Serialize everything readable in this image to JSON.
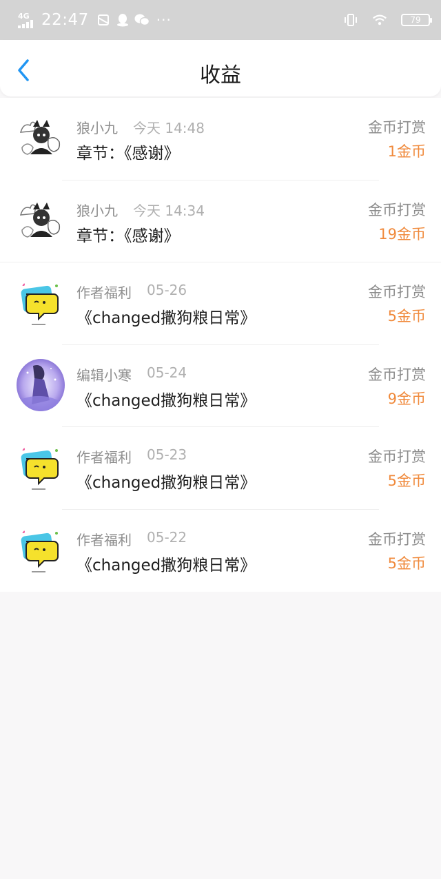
{
  "status_bar": {
    "network": "4G",
    "time": "22:47",
    "dots": "···",
    "battery": "79"
  },
  "header": {
    "title": "收益"
  },
  "colors": {
    "accent_blue": "#2196f3",
    "amount_orange": "#f08a3c"
  },
  "records": [
    {
      "name": "狼小九",
      "time": "今天 14:48",
      "content": "章节：《感谢》",
      "type": "金币打赏",
      "amount": "1金币",
      "avatar": "wolf-avatar-icon"
    },
    {
      "name": "狼小九",
      "time": "今天 14:34",
      "content": "章节：《感谢》",
      "type": "金币打赏",
      "amount": "19金币",
      "avatar": "wolf-avatar-icon"
    },
    {
      "name": "作者福利",
      "time": "05-26",
      "content": "《changed撒狗粮日常》",
      "type": "金币打赏",
      "amount": "5金币",
      "avatar": "chat-bubble-avatar-icon"
    },
    {
      "name": "编辑小寒",
      "time": "05-24",
      "content": "《changed撒狗粮日常》",
      "type": "金币打赏",
      "amount": "9金币",
      "avatar": "purple-anime-avatar-icon"
    },
    {
      "name": "作者福利",
      "time": "05-23",
      "content": "《changed撒狗粮日常》",
      "type": "金币打赏",
      "amount": "5金币",
      "avatar": "chat-bubble-avatar-icon"
    },
    {
      "name": "作者福利",
      "time": "05-22",
      "content": "《changed撒狗粮日常》",
      "type": "金币打赏",
      "amount": "5金币",
      "avatar": "chat-bubble-avatar-icon"
    }
  ]
}
